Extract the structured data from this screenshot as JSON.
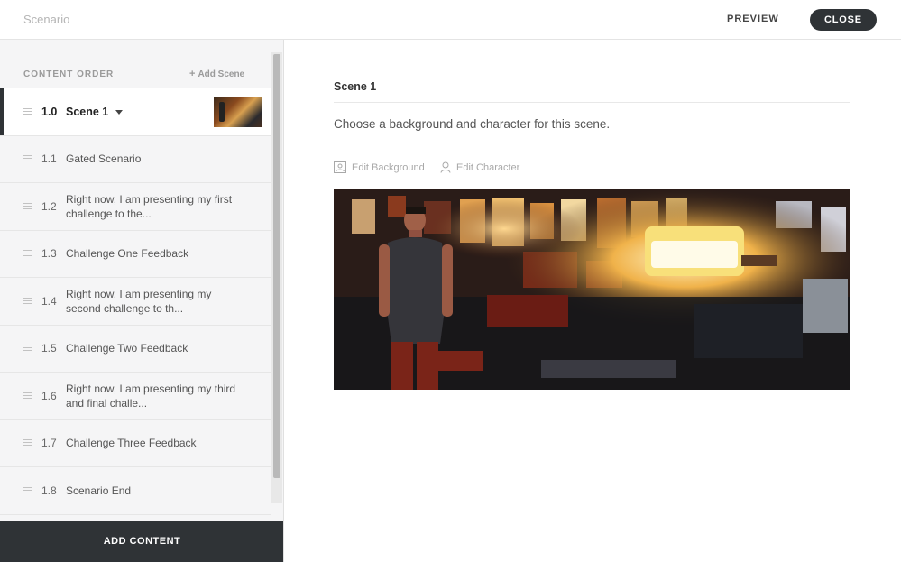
{
  "header": {
    "title": "Scenario",
    "preview_label": "PREVIEW",
    "close_label": "CLOSE"
  },
  "sidebar": {
    "section_title": "CONTENT ORDER",
    "add_scene_label": "Add Scene",
    "items": [
      {
        "number": "1.0",
        "label": "Scene 1",
        "active": true
      },
      {
        "number": "1.1",
        "label": "Gated Scenario"
      },
      {
        "number": "1.2",
        "label": "Right now, I am presenting my first challenge to the..."
      },
      {
        "number": "1.3",
        "label": "Challenge One Feedback"
      },
      {
        "number": "1.4",
        "label": "Right now, I am presenting my second challenge to th..."
      },
      {
        "number": "1.5",
        "label": "Challenge Two Feedback"
      },
      {
        "number": "1.6",
        "label": "Right now, I am presenting my third and final challe..."
      },
      {
        "number": "1.7",
        "label": "Challenge Three Feedback"
      },
      {
        "number": "1.8",
        "label": "Scenario End"
      }
    ],
    "add_content_label": "ADD CONTENT"
  },
  "main": {
    "scene_title": "Scene 1",
    "description": "Choose a background and character for this scene.",
    "edit_background_label": "Edit Background",
    "edit_character_label": "Edit Character"
  },
  "colors": {
    "dark": "#2f3336",
    "sidebar_bg": "#f5f5f6",
    "muted": "#a8a8a8"
  },
  "icons": [
    "plus-icon",
    "drag-handle-icon",
    "caret-down-icon",
    "image-icon",
    "person-icon"
  ]
}
